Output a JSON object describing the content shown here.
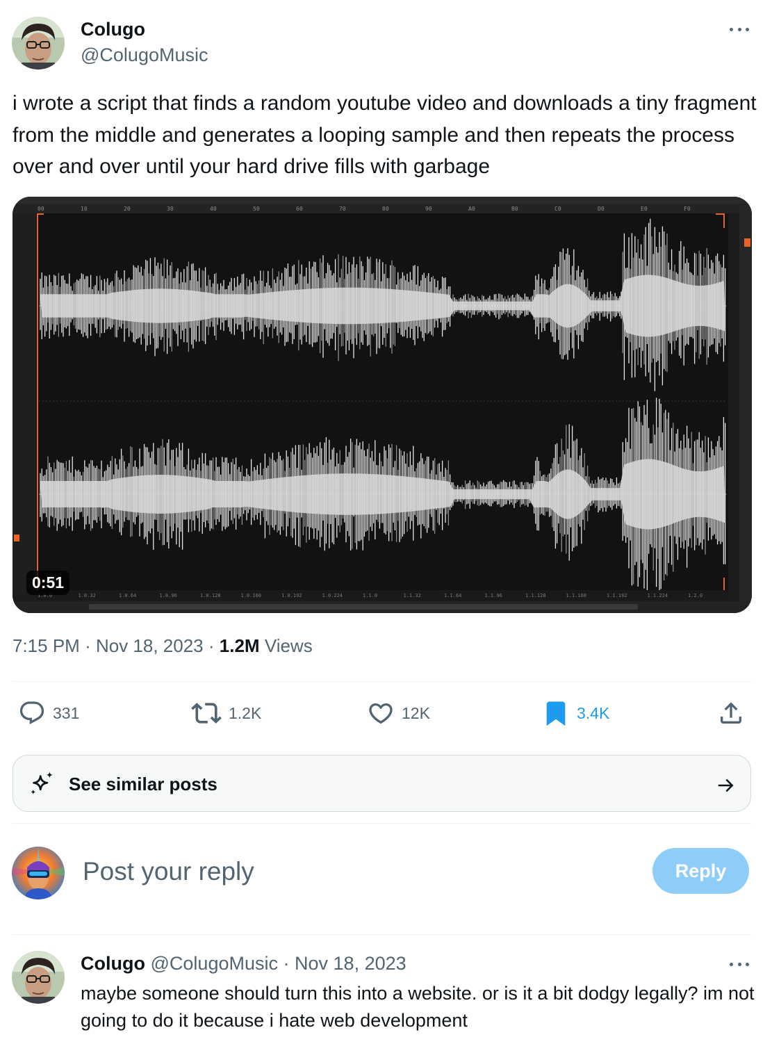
{
  "post": {
    "author_name": "Colugo",
    "author_handle": "@ColugoMusic",
    "text": "i wrote a script that finds a random youtube video and downloads a tiny fragment from the middle and generates a looping sample and then repeats the process over and over until your hard drive fills with garbage",
    "media": {
      "duration": "0:51",
      "ruler_labels": [
        "00",
        "10",
        "20",
        "30",
        "40",
        "50",
        "60",
        "70",
        "80",
        "90",
        "A0",
        "B0",
        "C0",
        "D0",
        "E0",
        "F0"
      ],
      "bottom_labels": [
        "1.0.0",
        "1.0.32",
        "1.0.64",
        "1.0.96",
        "1.0.128",
        "1.0.160",
        "1.0.192",
        "1.0.224",
        "1.1.0",
        "1.1.32",
        "1.1.64",
        "1.1.96",
        "1.1.128",
        "1.1.160",
        "1.1.192",
        "1.1.224",
        "1.2.0"
      ]
    },
    "time": "7:15 PM",
    "date": "Nov 18, 2023",
    "views_count": "1.2M",
    "views_label": "Views",
    "separator": "·",
    "stats": {
      "replies": "331",
      "reposts": "1.2K",
      "likes": "12K",
      "bookmarks": "3.4K"
    },
    "colors": {
      "accent": "#1d9bf0",
      "secondary_text": "#536471",
      "waveform_bg": "#121212",
      "daw_orange": "#e8632a"
    }
  },
  "similar": {
    "label": "See similar posts"
  },
  "reply_box": {
    "placeholder": "Post your reply",
    "button_label": "Reply"
  },
  "comment": {
    "author_name": "Colugo",
    "author_handle": "@ColugoMusic",
    "separator": "·",
    "date": "Nov 18, 2023",
    "text": "maybe someone should turn this into a website. or is it a bit dodgy legally? im not going to do it because i hate web development"
  },
  "icons": [
    "more-icon",
    "reply-icon",
    "repost-icon",
    "like-icon",
    "bookmark-icon",
    "share-icon",
    "sparkle-icon",
    "arrow-right-icon"
  ]
}
